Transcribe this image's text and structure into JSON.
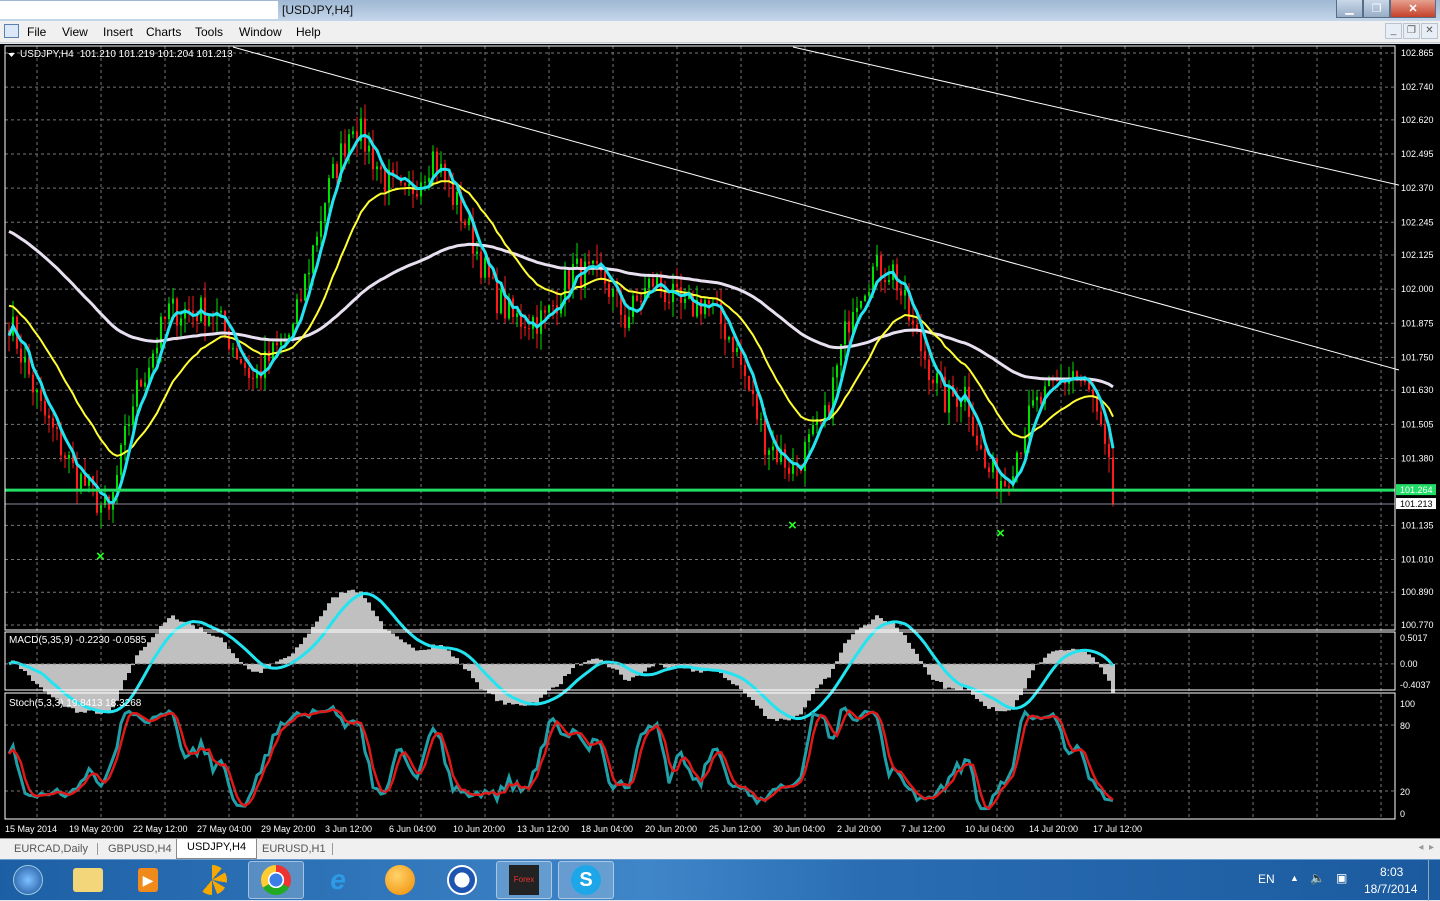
{
  "window": {
    "title": "[USDJPY,H4]"
  },
  "menu": [
    "File",
    "View",
    "Insert",
    "Charts",
    "Tools",
    "Window",
    "Help"
  ],
  "chart": {
    "symbol_label": "USDJPY,H4",
    "ohlc": "101.210 101.219 101.204 101.213",
    "price_ticks": [
      "102.865",
      "102.740",
      "102.620",
      "102.495",
      "102.370",
      "102.245",
      "102.125",
      "102.000",
      "101.875",
      "101.750",
      "101.630",
      "101.505",
      "101.380",
      "101.135",
      "101.010",
      "100.890",
      "100.770"
    ],
    "price_min": 100.77,
    "price_max": 102.865,
    "line_level": "101.264",
    "bid_level": "101.213",
    "time_labels": [
      "15 May 2014",
      "19 May 20:00",
      "22 May 12:00",
      "27 May 04:00",
      "29 May 20:00",
      "3 Jun 12:00",
      "6 Jun 04:00",
      "10 Jun 20:00",
      "13 Jun 12:00",
      "18 Jun 04:00",
      "20 Jun 20:00",
      "25 Jun 12:00",
      "30 Jun 04:00",
      "2 Jul 20:00",
      "7 Jul 12:00",
      "10 Jul 04:00",
      "14 Jul 20:00",
      "17 Jul 12:00"
    ],
    "bars": 277,
    "price_path": [
      [
        0,
        101.89
      ],
      [
        8,
        101.56
      ],
      [
        16,
        101.34
      ],
      [
        25,
        101.17
      ],
      [
        31,
        101.59
      ],
      [
        40,
        101.92
      ],
      [
        51,
        101.92
      ],
      [
        61,
        101.67
      ],
      [
        71,
        101.85
      ],
      [
        79,
        102.33
      ],
      [
        86,
        102.62
      ],
      [
        94,
        102.4
      ],
      [
        99,
        102.33
      ],
      [
        106,
        102.49
      ],
      [
        114,
        102.25
      ],
      [
        121,
        101.99
      ],
      [
        126,
        101.89
      ],
      [
        134,
        101.89
      ],
      [
        141,
        102.07
      ],
      [
        149,
        102.03
      ],
      [
        154,
        101.89
      ],
      [
        161,
        102.03
      ],
      [
        169,
        101.92
      ],
      [
        174,
        101.96
      ],
      [
        181,
        101.81
      ],
      [
        189,
        101.45
      ],
      [
        196,
        101.34
      ],
      [
        204,
        101.52
      ],
      [
        211,
        101.96
      ],
      [
        216,
        102.07
      ],
      [
        221,
        102.07
      ],
      [
        226,
        101.85
      ],
      [
        234,
        101.59
      ],
      [
        239,
        101.63
      ],
      [
        244,
        101.34
      ],
      [
        249,
        101.3
      ],
      [
        256,
        101.56
      ],
      [
        266,
        101.7
      ],
      [
        271,
        101.59
      ],
      [
        276,
        101.26
      ]
    ],
    "x_markers": [
      [
        23,
        101.022
      ],
      [
        196,
        101.136
      ],
      [
        248,
        101.107
      ]
    ],
    "trendlines": [
      [
        [
          56,
          102.887
        ],
        [
          347.5,
          101.704
        ]
      ],
      [
        [
          196,
          102.887
        ],
        [
          347.5,
          102.381
        ]
      ]
    ],
    "colors": {
      "bull": "#00e000",
      "bear": "#ff1a1a",
      "fast_ma": "#22e4f0",
      "mid_ma": "#ffff33",
      "slow_ma": "#e8e0f0",
      "level": "#22dd66"
    }
  },
  "macd": {
    "label": "MACD(5,35,9) -0.2230 -0.0585",
    "ticks": [
      "0.5017",
      "0.00",
      "-0.4037"
    ]
  },
  "stoch": {
    "label": "Stoch(5,3,3) 19.8413 18.3268",
    "ticks": [
      "100",
      "80",
      "20",
      "0"
    ]
  },
  "tabs": [
    "EURCAD,Daily",
    "GBPUSD,H4",
    "USDJPY,H4",
    "EURUSD,H1"
  ],
  "active_tab": "USDJPY,H4",
  "taskbar": {
    "forex_label": "Forex"
  },
  "tray": {
    "lang": "EN",
    "time": "8:03",
    "date": "18/7/2014"
  }
}
